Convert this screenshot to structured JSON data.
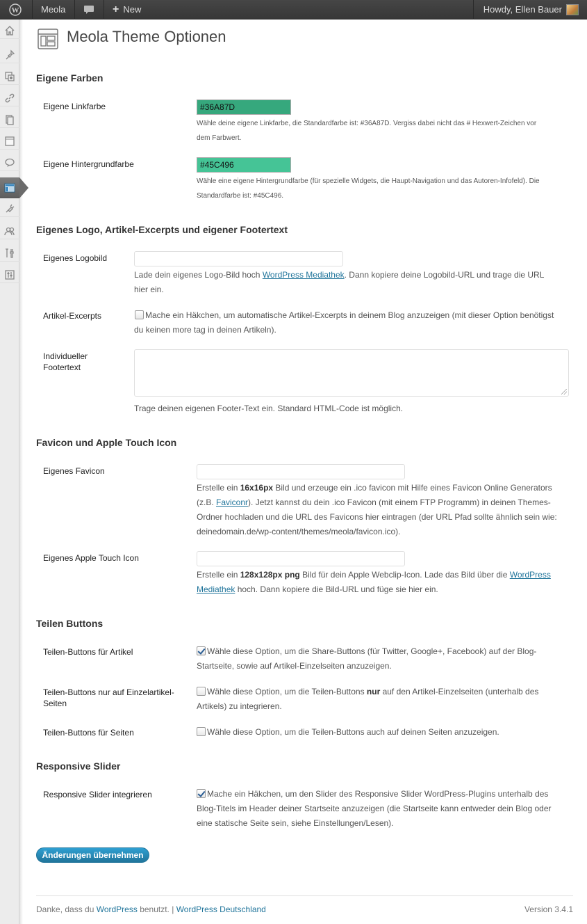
{
  "adminbar": {
    "site_name": "Meola",
    "new_label": "New",
    "howdy": "Howdy, Ellen Bauer"
  },
  "sidebar": {
    "icons": [
      "dashboard-icon",
      "posts-icon",
      "media-icon",
      "links-icon",
      "pages-icon",
      "generic-page-icon",
      "comments-icon",
      "appearance-icon",
      "plugins-icon",
      "users-icon",
      "tools-icon",
      "settings-icon"
    ],
    "current": "appearance-icon"
  },
  "page": {
    "title": "Meola Theme Optionen"
  },
  "sections": {
    "colors": {
      "title": "Eigene Farben",
      "link_label": "Eigene Linkfarbe",
      "link_value": "#36A87D",
      "link_color": "#36A87D",
      "link_desc_1": "Wähle deine eigene Linkfarbe, die Standardfarbe ist: #36A87D. Vergiss dabei nicht das # Hexwert-Zeichen vor",
      "link_desc_2": "dem Farbwert.",
      "bg_label": "Eigene Hintergrundfarbe",
      "bg_value": "#45C496",
      "bg_color": "#45C496",
      "bg_desc_1": "Wähle eine eigene Hintergrundfarbe (für spezielle Widgets, die Haupt-Navigation und das Autoren-Infofeld). Die",
      "bg_desc_2": "Standardfarbe ist: #45C496."
    },
    "logo": {
      "title": "Eigenes Logo, Artikel-Excerpts und eigener Footertext",
      "logo_label": "Eigenes Logobild",
      "logo_value": "",
      "logo_desc_pre": "Lade dein eigenes Logo-Bild hoch ",
      "logo_desc_link": "WordPress Mediathek",
      "logo_desc_post": ". Dann kopiere deine Logobild-URL und trage die URL",
      "logo_desc_2": "hier ein.",
      "excerpts_label": "Artikel-Excerpts",
      "excerpts_checked": false,
      "excerpts_text_1": "Mache ein Häkchen, um automatische Artikel-Excerpts in deinem Blog anzuzeigen (mit dieser Option benötigst",
      "excerpts_text_2": "du keinen more tag in deinen Artikeln).",
      "footer_label_1": "Individueller",
      "footer_label_2": "Footertext",
      "footer_value": "",
      "footer_desc": "Trage deinen eigenen Footer-Text ein. Standard HTML-Code ist möglich."
    },
    "favicon": {
      "title": "Favicon und Apple Touch Icon",
      "favicon_label": "Eigenes Favicon",
      "favicon_value": "",
      "favicon_desc_1_pre": "Erstelle ein ",
      "favicon_desc_1_bold": "16x16px",
      "favicon_desc_1_post": " Bild und erzeuge ein .ico favicon mit Hilfe eines Favicon Online Generators",
      "favicon_desc_2_pre": "(z.B. ",
      "favicon_desc_2_link": "Faviconr",
      "favicon_desc_2_post": "). Jetzt kannst du dein .ico Favicon (mit einem FTP Programm) in deinen Themes-",
      "favicon_desc_3": "Ordner hochladen und die URL des Favicons hier eintragen (der URL Pfad sollte ähnlich sein wie:",
      "favicon_desc_4": "deinedomain.de/wp-content/themes/meola/favicon.ico).",
      "apple_label": "Eigenes Apple Touch Icon",
      "apple_value": "",
      "apple_desc_1_pre": "Erstelle ein ",
      "apple_desc_1_bold": "128x128px png",
      "apple_desc_1_post": " Bild für dein Apple Webclip-Icon. Lade das Bild über die ",
      "apple_desc_1_link": "WordPress",
      "apple_desc_2_link": "Mediathek",
      "apple_desc_2_post": " hoch. Dann kopiere die Bild-URL und füge sie hier ein."
    },
    "share": {
      "title": "Teilen Buttons",
      "articles_label": "Teilen-Buttons für Artikel",
      "articles_checked": true,
      "articles_text_1": "Wähle diese Option, um die Share-Buttons (für Twitter, Google+, Facebook) auf der Blog-",
      "articles_text_2": "Startseite, sowie auf Artikel-Einzelseiten anzuzeigen.",
      "single_label_1": "Teilen-Buttons nur auf Einzelartikel-",
      "single_label_2": "Seiten",
      "single_checked": false,
      "single_text_1_pre": "Wähle diese Option, um die Teilen-Buttons ",
      "single_text_1_bold": "nur",
      "single_text_1_post": " auf den Artikel-Einzelseiten (unterhalb des",
      "single_text_2": "Artikels) zu integrieren.",
      "pages_label": "Teilen-Buttons für Seiten",
      "pages_checked": false,
      "pages_text": "Wähle diese Option, um die Teilen-Buttons auch auf deinen Seiten anzuzeigen."
    },
    "slider": {
      "title": "Responsive Slider",
      "label": "Responsive Slider integrieren",
      "checked": true,
      "text_1": "Mache ein Häkchen, um den Slider des Responsive Slider WordPress-Plugins unterhalb des",
      "text_2": "Blog-Titels im Header deiner Startseite anzuzeigen (die Startseite kann entweder dein Blog oder",
      "text_3": "eine statische Seite sein, siehe Einstellungen/Lesen)."
    }
  },
  "save_label": "Änderungen übernehmen",
  "footer": {
    "thanks_pre": "Danke, dass du ",
    "thanks_link": "WordPress",
    "thanks_post": " benutzt. | ",
    "de_link": "WordPress Deutschland",
    "version": "Version 3.4.1"
  }
}
